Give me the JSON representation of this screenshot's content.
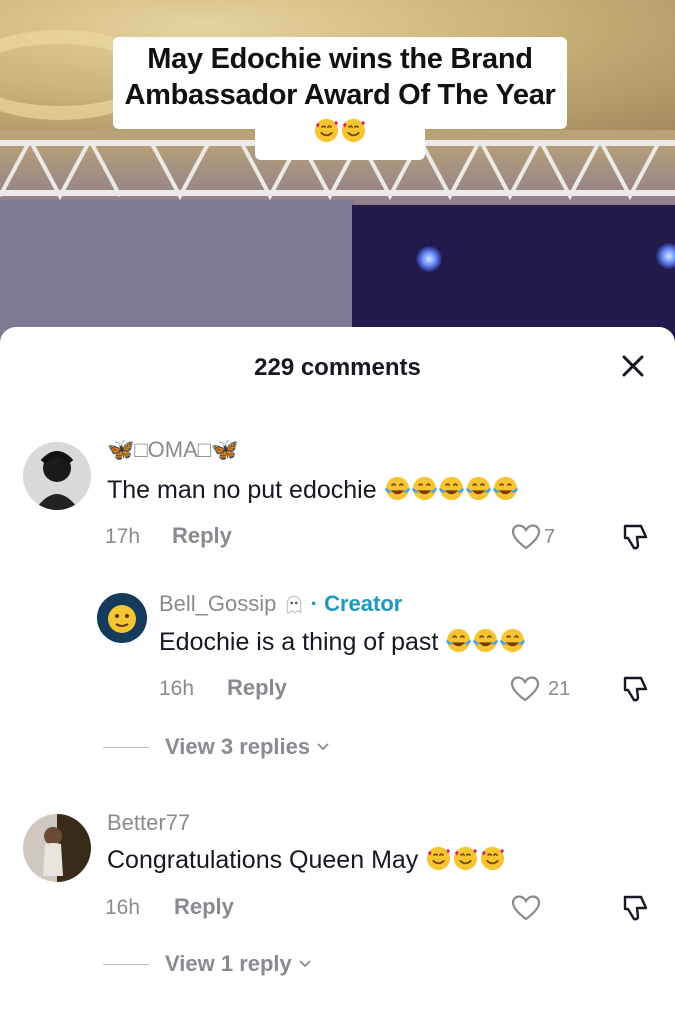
{
  "video": {
    "caption_text": "May Edochie wins the Brand Ambassador Award Of The Year",
    "caption_emoji": "smiling-face-with-hearts"
  },
  "comments_panel": {
    "title": "229 comments",
    "close_icon": "close-icon"
  },
  "comments": [
    {
      "username": "🦋\u0000OMA\u0000🦋",
      "username_display": "🦋□OMA□🦋",
      "text": "The man no put edochie",
      "emoji": "face-with-tears-of-joy",
      "emoji_count": 5,
      "time": "17h",
      "reply_label": "Reply",
      "likes": "7"
    },
    {
      "username": "Bell_Gossip",
      "username_suffix_icon": "ghost-icon",
      "creator_label": "· Creator",
      "text": "Edochie is a thing of past",
      "emoji": "face-with-tears-of-joy",
      "emoji_count": 3,
      "time": "16h",
      "reply_label": "Reply",
      "likes": "21",
      "is_reply": true
    },
    {
      "username": "Better77",
      "text": "Congratulations Queen May",
      "emoji": "smiling-face-with-hearts",
      "emoji_count": 3,
      "time": "16h",
      "reply_label": "Reply",
      "likes": ""
    }
  ],
  "view_replies": [
    {
      "label": "View 3 replies"
    },
    {
      "label": "View 1 reply"
    }
  ],
  "colors": {
    "text_primary": "#161823",
    "text_secondary": "#8a8b91",
    "creator_accent": "#1d9ab8",
    "emoji_yellow": "#f7c531"
  }
}
